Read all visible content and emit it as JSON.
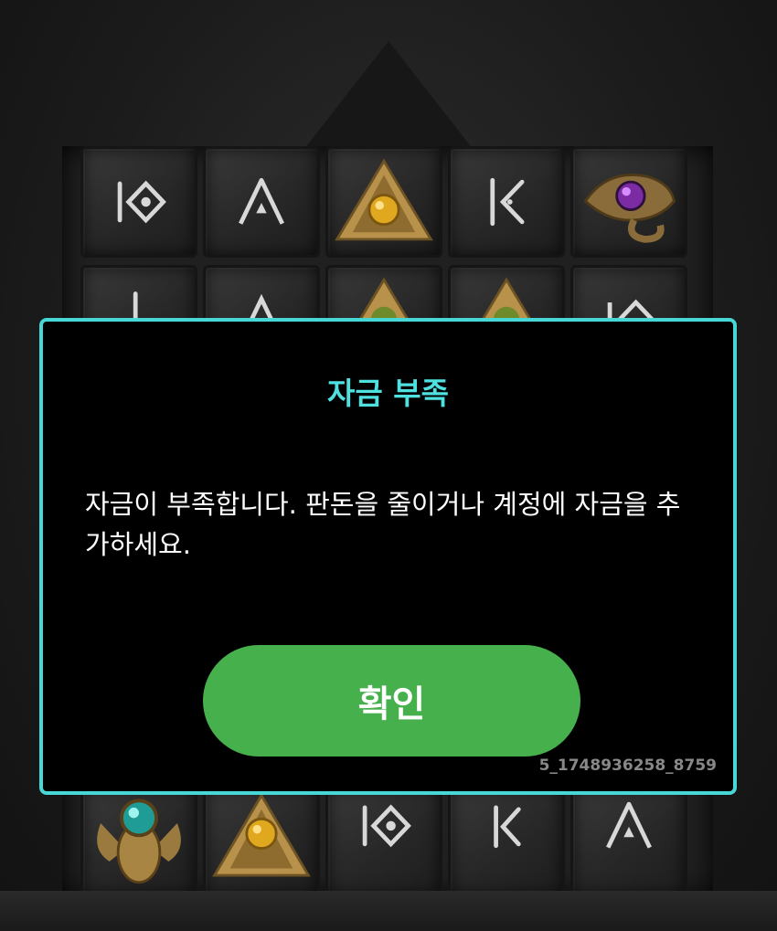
{
  "dialog": {
    "title": "자금 부족",
    "message": "자금이 부족합니다. 판돈을 줄이거나 계정에 자금을 추가하세요.",
    "confirm_label": "확인",
    "session_id": "5_1748936258_8759",
    "accent_color": "#47d7d7",
    "button_color": "#46b04c"
  },
  "board": {
    "row1": [
      "rune-diamond-icon",
      "rune-a-icon",
      "pyramid-amber-gem-icon",
      "rune-k-icon",
      "eye-of-horus-purple-gem-icon"
    ],
    "row2": [
      "rune-j-icon",
      "rune-a-icon",
      "pyramid-green-gem-icon",
      "pyramid-green-gem-icon",
      "rune-diamond-icon"
    ],
    "row3": [
      "scarab-turquoise-gem-icon",
      "pyramid-amber-gem-icon",
      "rune-diamond-icon",
      "rune-j-icon",
      "rune-a-icon"
    ]
  }
}
